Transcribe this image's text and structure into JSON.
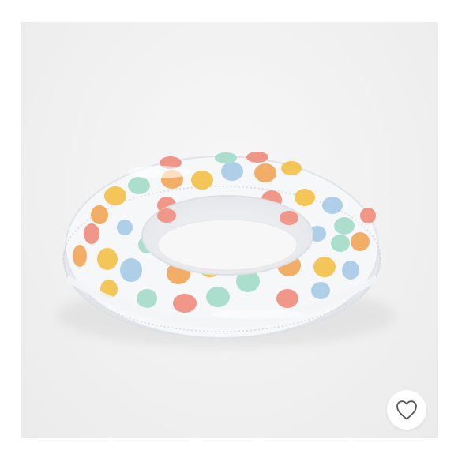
{
  "listing": {
    "image_subject": "polka-dot-swim-ring",
    "dot_colors": [
      "#f1a8a0",
      "#f4c24a",
      "#f2a85a",
      "#a6dcca",
      "#a9cbe6",
      "#f08f80"
    ]
  },
  "actions": {
    "like_icon": "heart-outline-icon",
    "like_icon_color": "#555555"
  }
}
